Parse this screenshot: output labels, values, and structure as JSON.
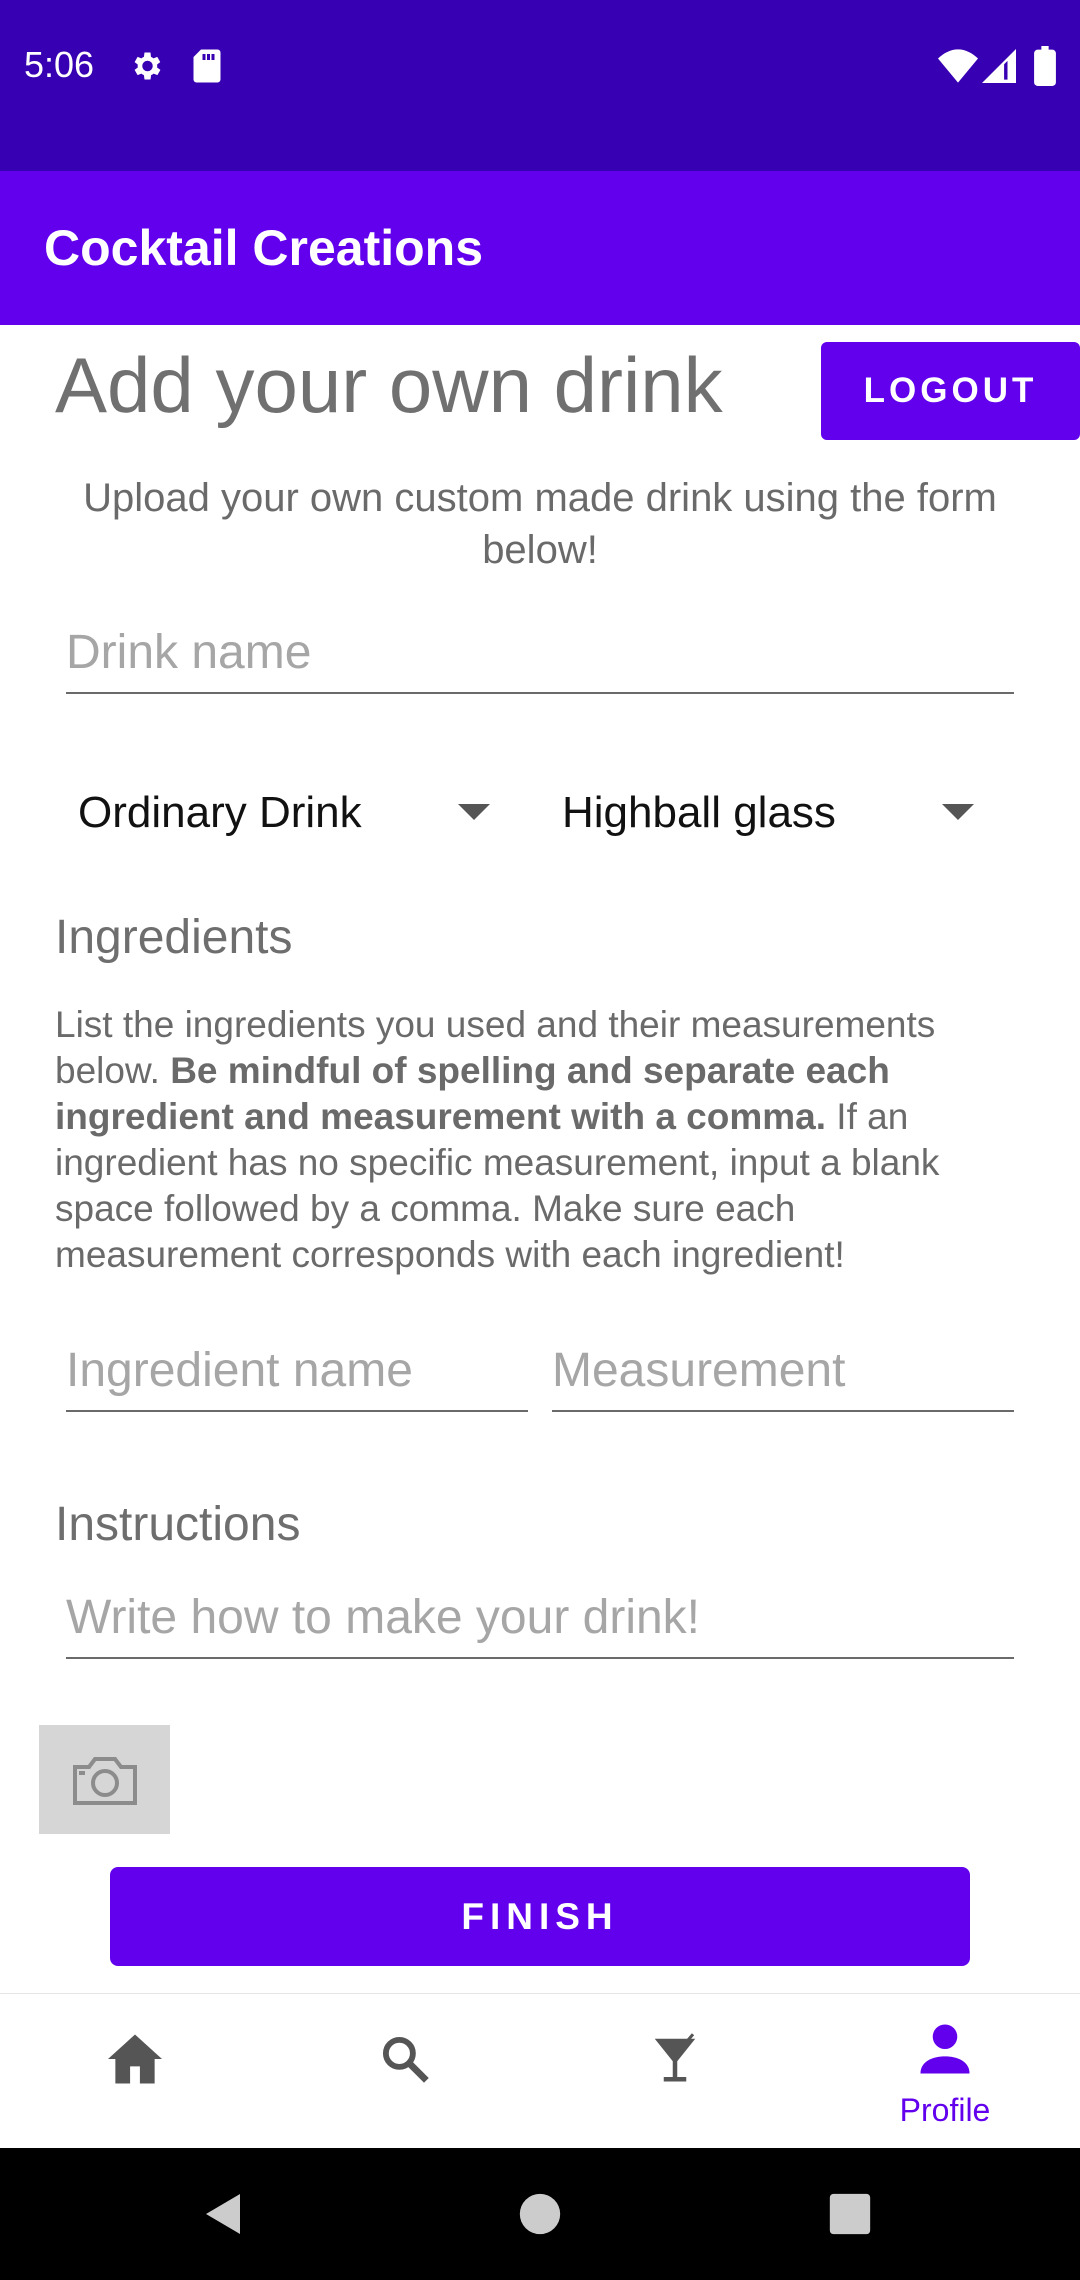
{
  "status_bar": {
    "time": "5:06",
    "background": "#3700b3",
    "icons": [
      "gear-icon",
      "sd-card-icon",
      "wifi-icon",
      "signal-icon",
      "battery-icon"
    ]
  },
  "app_bar": {
    "title": "Cocktail Creations",
    "background": "#6200ee"
  },
  "page": {
    "heading": "Add your own drink",
    "logout_label": "LOGOUT",
    "subtitle": "Upload your own custom made drink using the form below!"
  },
  "form": {
    "drink_name_placeholder": "Drink name",
    "category_selected": "Ordinary Drink",
    "glass_selected": "Highball glass",
    "ingredients_label": "Ingredients",
    "ingredients_help_1": "List the ingredients you used and their measurements below. ",
    "ingredients_help_bold": "Be mindful of spelling and separate each ingredient and measurement with a comma.",
    "ingredients_help_2": " If an ingredient has no specific measurement, input a blank space followed by a comma. Make sure each measurement corresponds with each ingredient!",
    "ingredient_name_placeholder": "Ingredient name",
    "measurement_placeholder": "Measurement",
    "instructions_label": "Instructions",
    "instructions_placeholder": "Write how to make your drink!",
    "finish_label": "FINISH"
  },
  "bottom_nav": {
    "items": [
      {
        "icon": "home-icon",
        "label": ""
      },
      {
        "icon": "search-icon",
        "label": ""
      },
      {
        "icon": "cocktail-icon",
        "label": ""
      },
      {
        "icon": "profile-icon",
        "label": "Profile"
      }
    ],
    "active_color": "#6200ee",
    "inactive_color": "#555555"
  },
  "system_nav": {
    "icons": [
      "back-icon",
      "home-circle-icon",
      "recents-icon"
    ]
  }
}
